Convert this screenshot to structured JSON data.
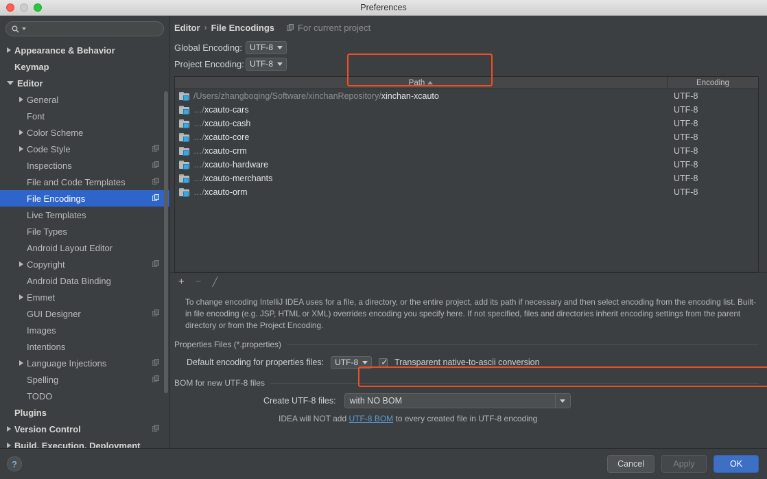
{
  "window": {
    "title": "Preferences",
    "controls": [
      "close",
      "minimize",
      "zoom"
    ]
  },
  "sidebar": {
    "search": {
      "value": "",
      "placeholder": ""
    },
    "items": [
      {
        "label": "Appearance & Behavior",
        "arrow": "right",
        "indent": 0,
        "bold": true,
        "copy": false,
        "selected": false
      },
      {
        "label": "Keymap",
        "arrow": "none",
        "indent": 0,
        "bold": true,
        "copy": false,
        "selected": false
      },
      {
        "label": "Editor",
        "arrow": "down",
        "indent": 0,
        "bold": true,
        "copy": false,
        "selected": false
      },
      {
        "label": "General",
        "arrow": "right",
        "indent": 1,
        "bold": false,
        "copy": false,
        "selected": false
      },
      {
        "label": "Font",
        "arrow": "none",
        "indent": 1,
        "bold": false,
        "copy": false,
        "selected": false
      },
      {
        "label": "Color Scheme",
        "arrow": "right",
        "indent": 1,
        "bold": false,
        "copy": false,
        "selected": false
      },
      {
        "label": "Code Style",
        "arrow": "right",
        "indent": 1,
        "bold": false,
        "copy": true,
        "selected": false
      },
      {
        "label": "Inspections",
        "arrow": "none",
        "indent": 1,
        "bold": false,
        "copy": true,
        "selected": false
      },
      {
        "label": "File and Code Templates",
        "arrow": "none",
        "indent": 1,
        "bold": false,
        "copy": true,
        "selected": false
      },
      {
        "label": "File Encodings",
        "arrow": "none",
        "indent": 1,
        "bold": false,
        "copy": true,
        "selected": true
      },
      {
        "label": "Live Templates",
        "arrow": "none",
        "indent": 1,
        "bold": false,
        "copy": false,
        "selected": false
      },
      {
        "label": "File Types",
        "arrow": "none",
        "indent": 1,
        "bold": false,
        "copy": false,
        "selected": false
      },
      {
        "label": "Android Layout Editor",
        "arrow": "none",
        "indent": 1,
        "bold": false,
        "copy": false,
        "selected": false
      },
      {
        "label": "Copyright",
        "arrow": "right",
        "indent": 1,
        "bold": false,
        "copy": true,
        "selected": false
      },
      {
        "label": "Android Data Binding",
        "arrow": "none",
        "indent": 1,
        "bold": false,
        "copy": false,
        "selected": false
      },
      {
        "label": "Emmet",
        "arrow": "right",
        "indent": 1,
        "bold": false,
        "copy": false,
        "selected": false
      },
      {
        "label": "GUI Designer",
        "arrow": "none",
        "indent": 1,
        "bold": false,
        "copy": true,
        "selected": false
      },
      {
        "label": "Images",
        "arrow": "none",
        "indent": 1,
        "bold": false,
        "copy": false,
        "selected": false
      },
      {
        "label": "Intentions",
        "arrow": "none",
        "indent": 1,
        "bold": false,
        "copy": false,
        "selected": false
      },
      {
        "label": "Language Injections",
        "arrow": "right",
        "indent": 1,
        "bold": false,
        "copy": true,
        "selected": false
      },
      {
        "label": "Spelling",
        "arrow": "none",
        "indent": 1,
        "bold": false,
        "copy": true,
        "selected": false
      },
      {
        "label": "TODO",
        "arrow": "none",
        "indent": 1,
        "bold": false,
        "copy": false,
        "selected": false
      },
      {
        "label": "Plugins",
        "arrow": "none",
        "indent": 0,
        "bold": true,
        "copy": false,
        "selected": false
      },
      {
        "label": "Version Control",
        "arrow": "right",
        "indent": 0,
        "bold": true,
        "copy": true,
        "selected": false
      },
      {
        "label": "Build, Execution, Deployment",
        "arrow": "right",
        "indent": 0,
        "bold": true,
        "copy": false,
        "selected": false
      }
    ]
  },
  "breadcrumb": {
    "parent": "Editor",
    "separator": "›",
    "current": "File Encodings",
    "note": "For current project"
  },
  "encodings": {
    "global_label": "Global Encoding:",
    "global_value": "UTF-8",
    "project_label": "Project Encoding:",
    "project_value": "UTF-8"
  },
  "table": {
    "columns": [
      "Path",
      "Encoding"
    ],
    "sort_column": "Path",
    "sort_direction": "asc",
    "rows": [
      {
        "prefix": "/Users/zhangboqing/Software/xinchanRepository/",
        "name": "xinchan-xcauto",
        "encoding": "UTF-8"
      },
      {
        "prefix": "…/",
        "name": "xcauto-cars",
        "encoding": "UTF-8"
      },
      {
        "prefix": "…/",
        "name": "xcauto-cash",
        "encoding": "UTF-8"
      },
      {
        "prefix": "…/",
        "name": "xcauto-core",
        "encoding": "UTF-8"
      },
      {
        "prefix": "…/",
        "name": "xcauto-crm",
        "encoding": "UTF-8"
      },
      {
        "prefix": "…/",
        "name": "xcauto-hardware",
        "encoding": "UTF-8"
      },
      {
        "prefix": "…/",
        "name": "xcauto-merchants",
        "encoding": "UTF-8"
      },
      {
        "prefix": "…/",
        "name": "xcauto-orm",
        "encoding": "UTF-8"
      }
    ]
  },
  "table_toolbar": {
    "add": "+",
    "remove": "−",
    "edit": "╱"
  },
  "help_text": "To change encoding IntelliJ IDEA uses for a file, a directory, or the entire project, add its path if necessary and then select encoding from the encoding list. Built-in file encoding (e.g. JSP, HTML or XML) overrides encoding you specify here. If not specified, files and directories inherit encoding settings from the parent directory or from the Project Encoding.",
  "properties_section": {
    "title": "Properties Files (*.properties)",
    "default_encoding_label": "Default encoding for properties files:",
    "default_encoding_value": "UTF-8",
    "checkbox_label": "Transparent native-to-ascii conversion",
    "checkbox_checked": true
  },
  "bom_section": {
    "title": "BOM for new UTF-8 files",
    "create_label": "Create UTF-8 files:",
    "create_value": "with NO BOM",
    "note_prefix": "IDEA will NOT add ",
    "note_link": "UTF-8 BOM",
    "note_suffix": " to every created file in UTF-8 encoding"
  },
  "footer": {
    "help": "?",
    "cancel": "Cancel",
    "apply": "Apply",
    "ok": "OK"
  },
  "colors": {
    "background": "#3c3f41",
    "selection": "#2f65ca",
    "annotation": "#f04e23",
    "primary_button": "#3d6fc4",
    "link": "#5b9bd5",
    "folder_badge": "#3aa7e0"
  }
}
